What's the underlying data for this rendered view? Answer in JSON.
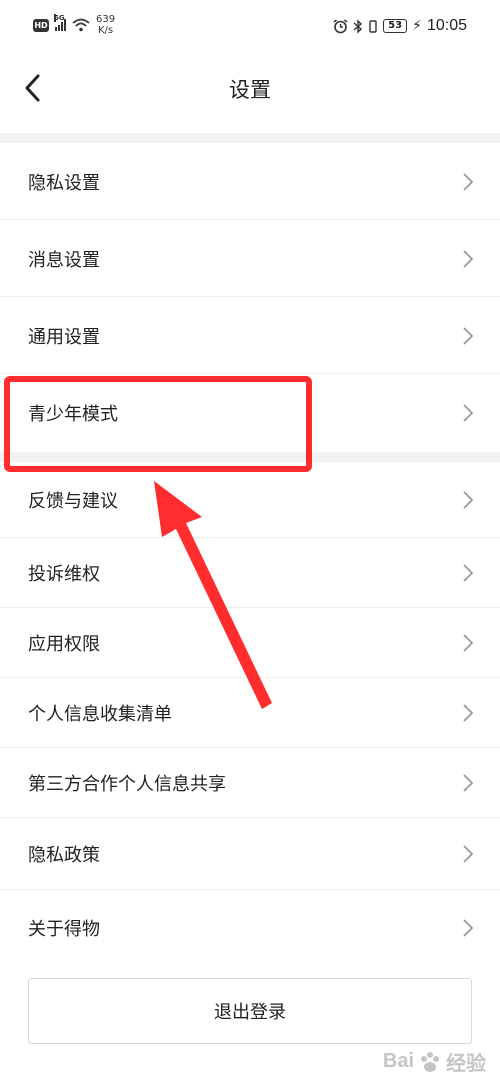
{
  "status_bar": {
    "hd": "HD",
    "network": "5G",
    "speed_value": "639",
    "speed_unit": "K/s",
    "battery": "53",
    "time": "10:05"
  },
  "header": {
    "title": "设置"
  },
  "menu": {
    "privacy_settings": "隐私设置",
    "message_settings": "消息设置",
    "general_settings": "通用设置",
    "teen_mode": "青少年模式",
    "feedback": "反馈与建议",
    "complaint": "投诉维权",
    "app_permissions": "应用权限",
    "personal_info_list": "个人信息收集清单",
    "third_party_sharing": "第三方合作个人信息共享",
    "privacy_policy": "隐私政策",
    "about": "关于得物"
  },
  "logout_label": "退出登录",
  "watermark": {
    "text_left": "Bai",
    "text_right": "经验"
  },
  "colors": {
    "highlight": "#ff2d2d",
    "divider": "#f2f2f4"
  }
}
